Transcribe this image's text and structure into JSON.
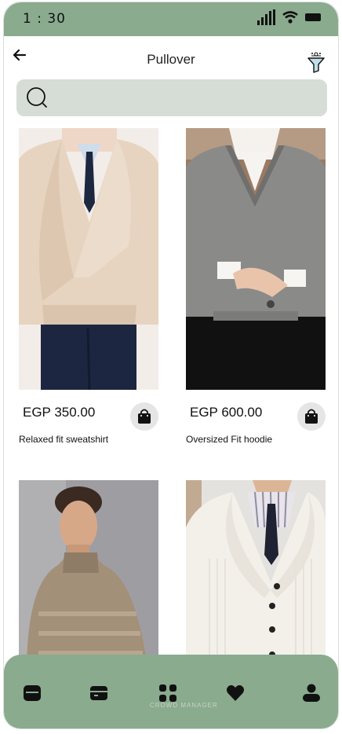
{
  "status_bar": {
    "time": "1 : 30",
    "icons": [
      "signal-icon",
      "wifi-icon",
      "battery-icon"
    ]
  },
  "header": {
    "title": "Pullover",
    "back_icon": "arrow-left-icon",
    "filter_icon": "filter-icon"
  },
  "search": {
    "placeholder": "",
    "icon": "search-icon"
  },
  "products": [
    {
      "price": "EGP 350.00",
      "name": "Relaxed fit sweatshirt"
    },
    {
      "price": "EGP 600.00",
      "name": "Oversized Fit hoodie"
    },
    {
      "price": "",
      "name": ""
    },
    {
      "price": "",
      "name": ""
    }
  ],
  "tabbar": {
    "items": [
      "home-icon",
      "wallet-icon",
      "categories-icon",
      "heart-icon",
      "profile-icon"
    ],
    "watermark": "CROWD MANAGER"
  },
  "colors": {
    "accent": "#8aab8e",
    "search_bg": "#d6ddd7",
    "bag_bg": "#e5e5e5"
  }
}
